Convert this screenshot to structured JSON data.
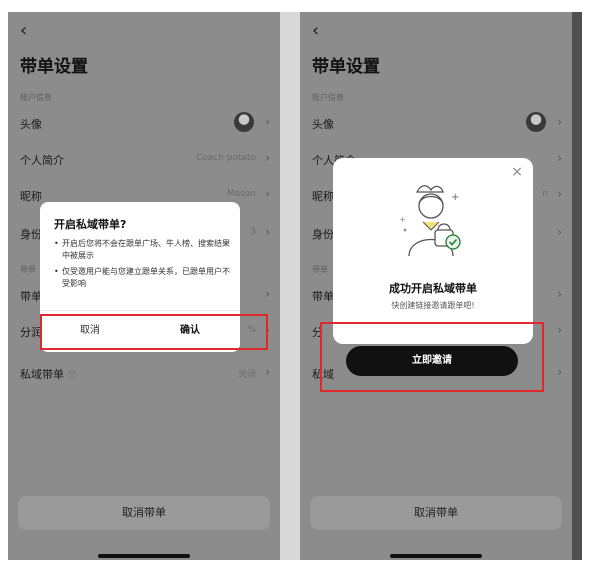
{
  "left": {
    "back_icon": "‹",
    "page_title": "带单设置",
    "section_account": "账户信息",
    "avatar_label": "头像",
    "bio_label": "个人简介",
    "bio_value": "Coach potato",
    "nickname_label": "昵称",
    "nickname_value": "Mason",
    "identity_label": "身份",
    "identity_value": "3",
    "section_copy": "带单",
    "copy_label": "带单",
    "split_label": "分润",
    "split_value": "%",
    "private_label": "私域带单",
    "private_value": "关闭",
    "cancel_copy": "取消带单",
    "dialog": {
      "title": "开启私域带单?",
      "bullets": [
        "开启后您将不会在跟单广场、牛人榜、搜索结果中被展示",
        "仅受邀用户能与您建立跟单关系，已跟单用户不受影响"
      ],
      "cancel_label": "取消",
      "confirm_label": "确认"
    }
  },
  "right": {
    "back_icon": "‹",
    "page_title": "带单设置",
    "section_account": "账户信息",
    "avatar_label": "头像",
    "bio_label": "个人简介",
    "nickname_label": "昵称",
    "nickname_value": "n",
    "identity_label": "身份",
    "section_copy": "带单",
    "copy_label": "带单",
    "split_label": "分",
    "private_label": "私域",
    "cancel_copy": "取消带单",
    "success": {
      "close_icon": "×",
      "title": "成功开启私域带单",
      "subtitle": "快创建链接邀请跟单吧!",
      "invite_label": "立即邀请"
    }
  },
  "icons": [
    "back-icon",
    "chevron-right-icon",
    "info-icon",
    "close-icon",
    "success-illustration-icon"
  ],
  "colors": {
    "overlay_gray": "#8c8c8c",
    "highlight_red": "#e0282e",
    "invite_button": "#111111",
    "success_green": "#1f7a35"
  }
}
